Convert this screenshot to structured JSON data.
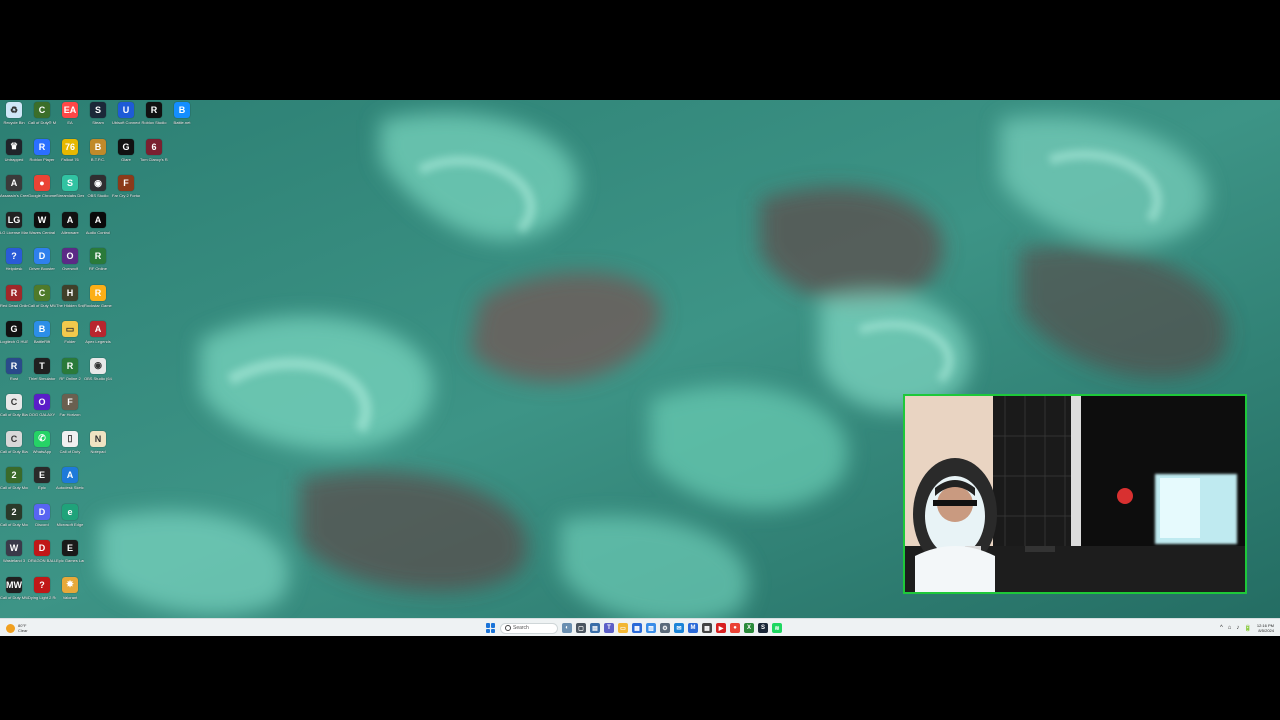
{
  "desktop": {
    "icons": [
      {
        "label": "Recycle Bin",
        "color": "#cfe6f7",
        "glyph": "♻",
        "col": 0,
        "row": 0
      },
      {
        "label": "Call of Duty® MW",
        "color": "#3b6e2a",
        "glyph": "C",
        "col": 1,
        "row": 0
      },
      {
        "label": "EA",
        "color": "#ff4747",
        "glyph": "EA",
        "col": 2,
        "row": 0
      },
      {
        "label": "Steam",
        "color": "#1b2838",
        "glyph": "S",
        "col": 3,
        "row": 0
      },
      {
        "label": "Ubisoft Connect",
        "color": "#1e5bd6",
        "glyph": "U",
        "col": 4,
        "row": 0
      },
      {
        "label": "Roblox Studio",
        "color": "#111111",
        "glyph": "R",
        "col": 5,
        "row": 0
      },
      {
        "label": "Battle.net",
        "color": "#148eff",
        "glyph": "B",
        "col": 6,
        "row": 0
      },
      {
        "label": "Untrapped",
        "color": "#20242a",
        "glyph": "♛",
        "col": 0,
        "row": 1
      },
      {
        "label": "Roblox Player",
        "color": "#2b6fff",
        "glyph": "R",
        "col": 1,
        "row": 1
      },
      {
        "label": "Fallout 76",
        "color": "#e6b800",
        "glyph": "76",
        "col": 2,
        "row": 1
      },
      {
        "label": "B.T.P.C.",
        "color": "#c08a2a",
        "glyph": "B",
        "col": 3,
        "row": 1
      },
      {
        "label": "Glare",
        "color": "#111111",
        "glyph": "G",
        "col": 4,
        "row": 1
      },
      {
        "label": "Tom Clancy's Rainbow Six",
        "color": "#7a2030",
        "glyph": "6",
        "col": 5,
        "row": 1
      },
      {
        "label": "Assassin's Creed Brot...",
        "color": "#3a3a3a",
        "glyph": "A",
        "col": 0,
        "row": 2
      },
      {
        "label": "Google Chrome",
        "color": "#ea4335",
        "glyph": "●",
        "col": 1,
        "row": 2
      },
      {
        "label": "Streamlabs Desktop",
        "color": "#31c3a2",
        "glyph": "S",
        "col": 2,
        "row": 2
      },
      {
        "label": "OBS Studio",
        "color": "#302e31",
        "glyph": "◉",
        "col": 3,
        "row": 2
      },
      {
        "label": "Far Cry 2 Fortune's",
        "color": "#8b3a1a",
        "glyph": "F",
        "col": 4,
        "row": 2
      },
      {
        "label": "LG License Manager",
        "color": "#222222",
        "glyph": "LG",
        "col": 0,
        "row": 3
      },
      {
        "label": "Waves Central",
        "color": "#0e0e0e",
        "glyph": "W",
        "col": 1,
        "row": 3
      },
      {
        "label": "Alienware",
        "color": "#111111",
        "glyph": "A",
        "col": 2,
        "row": 3
      },
      {
        "label": "Audio Control",
        "color": "#0a0a0a",
        "glyph": "A",
        "col": 3,
        "row": 3
      },
      {
        "label": "Helpdesk",
        "color": "#2a5bd7",
        "glyph": "?",
        "col": 0,
        "row": 4
      },
      {
        "label": "Driver Booster",
        "color": "#2f80ed",
        "glyph": "D",
        "col": 1,
        "row": 4
      },
      {
        "label": "Overwolf",
        "color": "#5b2a86",
        "glyph": "O",
        "col": 2,
        "row": 4
      },
      {
        "label": "RF Online",
        "color": "#2a7a3a",
        "glyph": "R",
        "col": 3,
        "row": 4
      },
      {
        "label": "Red Dead Online",
        "color": "#a0282a",
        "glyph": "R",
        "col": 0,
        "row": 5
      },
      {
        "label": "Call of Duty MW III",
        "color": "#4f7a2a",
        "glyph": "C",
        "col": 1,
        "row": 5
      },
      {
        "label": "The Hidden Sniper",
        "color": "#40402a",
        "glyph": "H",
        "col": 2,
        "row": 5
      },
      {
        "label": "Rockstar Games",
        "color": "#fcaf17",
        "glyph": "R",
        "col": 3,
        "row": 5
      },
      {
        "label": "Logitech G HUB",
        "color": "#111111",
        "glyph": "G",
        "col": 0,
        "row": 6
      },
      {
        "label": "BattleRift",
        "color": "#2c8ee8",
        "glyph": "B",
        "col": 1,
        "row": 6
      },
      {
        "label": "Folder",
        "color": "#f2c94c",
        "glyph": "▭",
        "col": 2,
        "row": 6
      },
      {
        "label": "Apex Legends",
        "color": "#b8262e",
        "glyph": "A",
        "col": 3,
        "row": 6
      },
      {
        "label": "Rust",
        "color": "#2a4a8a",
        "glyph": "R",
        "col": 0,
        "row": 7
      },
      {
        "label": "Thief Simulator",
        "color": "#202020",
        "glyph": "T",
        "col": 1,
        "row": 7
      },
      {
        "label": "RF Online 2",
        "color": "#2a7a3a",
        "glyph": "R",
        "col": 2,
        "row": 7
      },
      {
        "label": "OBS Studio (64bit)",
        "color": "#e8e8e8",
        "glyph": "◉",
        "col": 3,
        "row": 7
      },
      {
        "label": "Call of Duty Black Ops",
        "color": "#e8e8e8",
        "glyph": "C",
        "col": 0,
        "row": 8
      },
      {
        "label": "OOG GALAXY",
        "color": "#5a1ec8",
        "glyph": "O",
        "col": 1,
        "row": 8
      },
      {
        "label": "Far Horizon",
        "color": "#6a6050",
        "glyph": "F",
        "col": 2,
        "row": 8
      },
      {
        "label": "Call of Duty Black Ops",
        "color": "#d8d8d8",
        "glyph": "C",
        "col": 0,
        "row": 9
      },
      {
        "label": "WhatsApp",
        "color": "#25d366",
        "glyph": "✆",
        "col": 1,
        "row": 9
      },
      {
        "label": "Call of Duty",
        "color": "#f0f0f0",
        "glyph": "▯",
        "col": 2,
        "row": 9
      },
      {
        "label": "Notepad",
        "color": "#efe3c2",
        "glyph": "N",
        "col": 3,
        "row": 9
      },
      {
        "label": "Call of Duty Modern...",
        "color": "#3a6a2a",
        "glyph": "2",
        "col": 0,
        "row": 10
      },
      {
        "label": "Epic",
        "color": "#2a2a2a",
        "glyph": "E",
        "col": 1,
        "row": 10
      },
      {
        "label": "Autodesk Sketchbook",
        "color": "#1e7ad9",
        "glyph": "A",
        "col": 2,
        "row": 10
      },
      {
        "label": "Call of Duty Modern...",
        "color": "#2a3a2a",
        "glyph": "2",
        "col": 0,
        "row": 11
      },
      {
        "label": "Discord",
        "color": "#5865f2",
        "glyph": "D",
        "col": 1,
        "row": 11
      },
      {
        "label": "Microsoft Edge",
        "color": "#1fa37a",
        "glyph": "e",
        "col": 2,
        "row": 11
      },
      {
        "label": "Wasteland 3",
        "color": "#3a3a4a",
        "glyph": "W",
        "col": 0,
        "row": 12
      },
      {
        "label": "DRAGON BALL X...",
        "color": "#c01818",
        "glyph": "D",
        "col": 1,
        "row": 12
      },
      {
        "label": "Epic Games Launcher",
        "color": "#1a1a1a",
        "glyph": "E",
        "col": 2,
        "row": 12
      },
      {
        "label": "Call of Duty MW",
        "color": "#202020",
        "glyph": "MW",
        "col": 0,
        "row": 13
      },
      {
        "label": "Dying Light 2 Reloaded",
        "color": "#c01818",
        "glyph": "?",
        "col": 1,
        "row": 13
      },
      {
        "label": "Valorant",
        "color": "#e6a93a",
        "glyph": "✸",
        "col": 2,
        "row": 13
      }
    ]
  },
  "taskbar": {
    "weather": {
      "temp": "80°F",
      "condition": "Clear"
    },
    "search_placeholder": "Search",
    "apps": [
      {
        "name": "widgets",
        "color": "#6a8fb0",
        "glyph": "◐"
      },
      {
        "name": "task-view",
        "color": "#4a5560",
        "glyph": "▢"
      },
      {
        "name": "file-manager",
        "color": "#3a6ea8",
        "glyph": "▤"
      },
      {
        "name": "teams",
        "color": "#5b5fc7",
        "glyph": "T"
      },
      {
        "name": "explorer",
        "color": "#f2b632",
        "glyph": "▭"
      },
      {
        "name": "store",
        "color": "#2a6ad8",
        "glyph": "▦"
      },
      {
        "name": "photos",
        "color": "#3a8ee8",
        "glyph": "▨"
      },
      {
        "name": "settings",
        "color": "#5a6a7a",
        "glyph": "⚙"
      },
      {
        "name": "mail",
        "color": "#1a84d8",
        "glyph": "✉"
      },
      {
        "name": "malwarebytes",
        "color": "#2a6ad8",
        "glyph": "M"
      },
      {
        "name": "calculator",
        "color": "#444444",
        "glyph": "▦"
      },
      {
        "name": "youtube",
        "color": "#d82020",
        "glyph": "▶"
      },
      {
        "name": "chrome",
        "color": "#ea4335",
        "glyph": "●"
      },
      {
        "name": "xbox",
        "color": "#2a8a3a",
        "glyph": "X"
      },
      {
        "name": "steam",
        "color": "#1b2838",
        "glyph": "S"
      },
      {
        "name": "spotify",
        "color": "#1ed760",
        "glyph": "≋"
      }
    ],
    "tray_glyphs": [
      "^",
      "⌂",
      "♪",
      "🔋"
    ],
    "time": "12:16 PM",
    "date": "8/5/2024"
  },
  "webcam": {
    "border_color": "#1ec83a"
  }
}
